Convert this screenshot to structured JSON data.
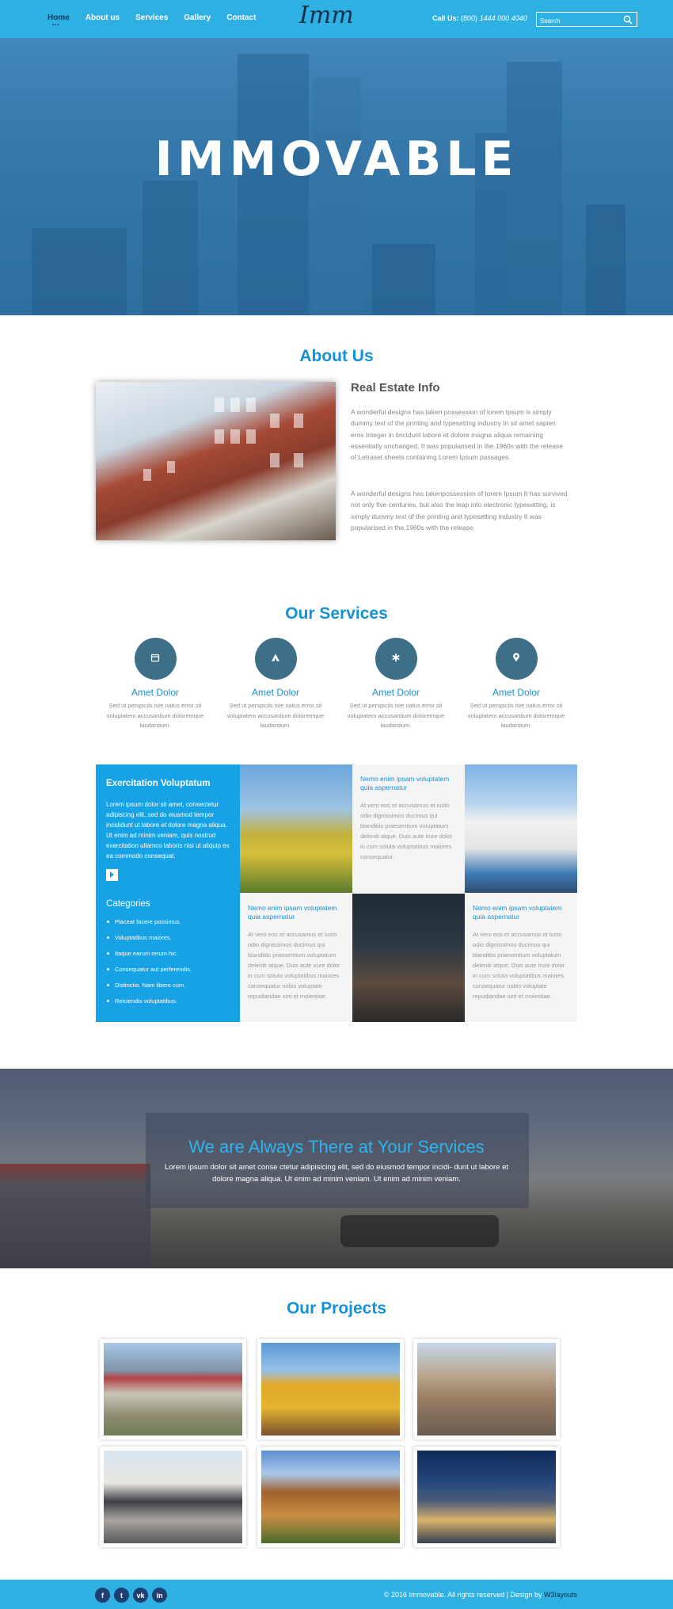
{
  "header": {
    "logo": "Imm",
    "nav": [
      "Home",
      "About us",
      "Services",
      "Gallery",
      "Contact"
    ],
    "call_label": "Call Us:",
    "call_code": "(800)",
    "call_number": "1444 000 4040",
    "search_placeholder": "Search",
    "colors": {
      "bar": "#2fb0e3",
      "active": "#0c3c5e"
    }
  },
  "hero": {
    "title": "IMMOVABLE"
  },
  "about": {
    "title": "About Us",
    "subtitle": "Real Estate Info",
    "p1": "A wonderful designs has taken possession of lorem Ipsum is simply dummy text of the printing and typesetting industry In sit amet sapien eros Integer in tincidunt labore et dolore magna aliqua remaining essentially unchanged. It was popularised in the 1960s with the release of Letraset sheets containing Lorem Ipsum passages.",
    "p2": "A wonderful designs has takenpossession of lorem Ipsum It has survived not only five centuries, but also the leap into electronic typesetting, is simply dummy text of the printing and typesetting industry It was popularised in the 1960s with the release"
  },
  "services": {
    "title": "Our Services",
    "items": [
      {
        "icon": "calendar-icon",
        "title": "Amet Dolor",
        "text": "Sed ut perspiciis iste natus error sit voluptatem accusantium doloremque laudantium."
      },
      {
        "icon": "tent-icon",
        "title": "Amet Dolor",
        "text": "Sed ut perspiciis iste natus error sit voluptatem accusantium doloremque laudantium."
      },
      {
        "icon": "asterisk-icon",
        "title": "Amet Dolor",
        "text": "Sed ut perspiciis iste natus error sit voluptatem accusantium doloremque laudantium."
      },
      {
        "icon": "map-pin-icon",
        "title": "Amet Dolor",
        "text": "Sed ut perspiciis iste natus error sit voluptatem accusantium doloremque laudantium."
      }
    ]
  },
  "feature": {
    "panel_title": "Exercitation Voluptatum",
    "panel_text": "Lorem ipsum dolor sit amet, consectetur adipiscing elit, sed do eiusmod tempor incididunt ut labore et dolore magna aliqua. Ut enim ad minim veniam, quis nostrud exercitation ullamco laboris nisi ut aliquip ex ea commodo consequat.",
    "categories_title": "Categories",
    "categories": [
      "Placeat facere possimus.",
      "Voluptatibus maiores.",
      "Itaque earum rerum hic.",
      "Consequatur aut perferendis.",
      "Distinctio. Nam libero cum.",
      "Reiciendis voluptatibus."
    ],
    "tiles": [
      {
        "title": "Nemo enim ipsam voluptatem quia aspernatur",
        "text": "At vero eos et accusamus et iusto odio dignissimos ducimus qui blanditiis praesentium voluptatum deleniti atque. Duis aute irure dolor in cum soluta voluptatibus maiores consequatur."
      },
      {
        "title": "Nemo enim ipsam voluptatem quia aspernatur",
        "text": "At vero eos et accusamus et iusto odio dignissimos ducimus qui blanditiis praesentium voluptatum deleniti atque. Duis aute irure dolor in cum soluta voluptatibus maiores consequatur nobis voluptate repudiandae sint et molestiae."
      },
      {
        "title": "Nemo enim ipsam voluptatem quia aspernatur",
        "text": "At vero eos et accusamus et iusto odio dignissimos ducimus qui blanditiis praesentium voluptatum deleniti atque. Duis aute irure dolor in cum soluta voluptatibus maiores consequatur nobis voluptate repudiandae sint et molestiae."
      }
    ]
  },
  "band": {
    "title": "We are Always There at Your Services",
    "text": "Lorem ipsum dolor sit amet conse ctetur adipisicing elit, sed do eiusmod tempor incidi- dunt ut labore et dolore magna aliqua. Ut enim ad minim veniam. Ut enim ad minim veniam."
  },
  "projects": {
    "title": "Our Projects"
  },
  "footer": {
    "social": [
      "facebook-icon",
      "twitter-icon",
      "vk-icon",
      "linkedin-icon"
    ],
    "social_glyphs": [
      "f",
      "t",
      "vk",
      "in"
    ],
    "copyright": "© 2016 Immovable. All rights reserved | Design by",
    "designer": "W3layouts"
  }
}
